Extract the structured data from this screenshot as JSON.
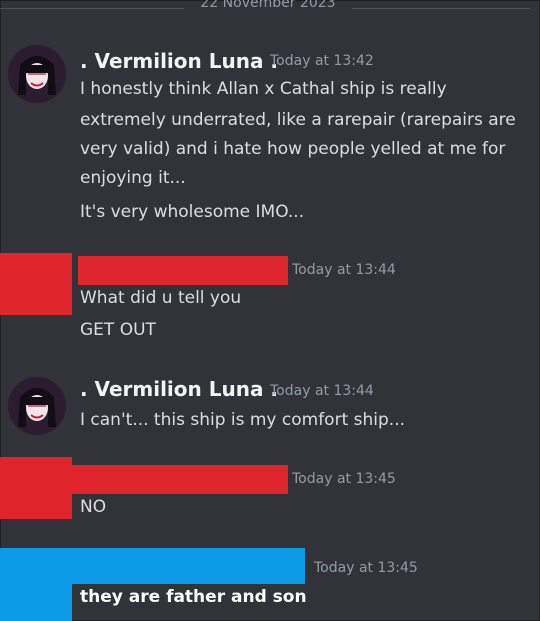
{
  "channel": {
    "date_divider": "22 November 2023"
  },
  "colors": {
    "red_redaction": "#e0262d",
    "blue_redaction": "#0b9be6"
  },
  "messages": [
    {
      "author": ". Vermilion Luna .",
      "timestamp": "Today at 13:42",
      "lines": [
        "I honestly think Allan x Cathal ship is really",
        "extremely underrated, like a rarepair (rarepairs are",
        "very valid) and i hate how people yelled at me for",
        "enjoying it...",
        "It's very wholesome IMO..."
      ]
    },
    {
      "author": "",
      "timestamp": "Today at 13:44",
      "lines": [
        "What did u tell you",
        "GET OUT"
      ]
    },
    {
      "author": ". Vermilion Luna .",
      "timestamp": "Today at 13:44",
      "lines": [
        "I can't... this ship is my comfort ship..."
      ]
    },
    {
      "author": "",
      "timestamp": "Today at 13:45",
      "lines": [
        "NO"
      ]
    },
    {
      "author": "",
      "timestamp": "Today at 13:45",
      "lines": [
        "they are father and son"
      ]
    }
  ]
}
